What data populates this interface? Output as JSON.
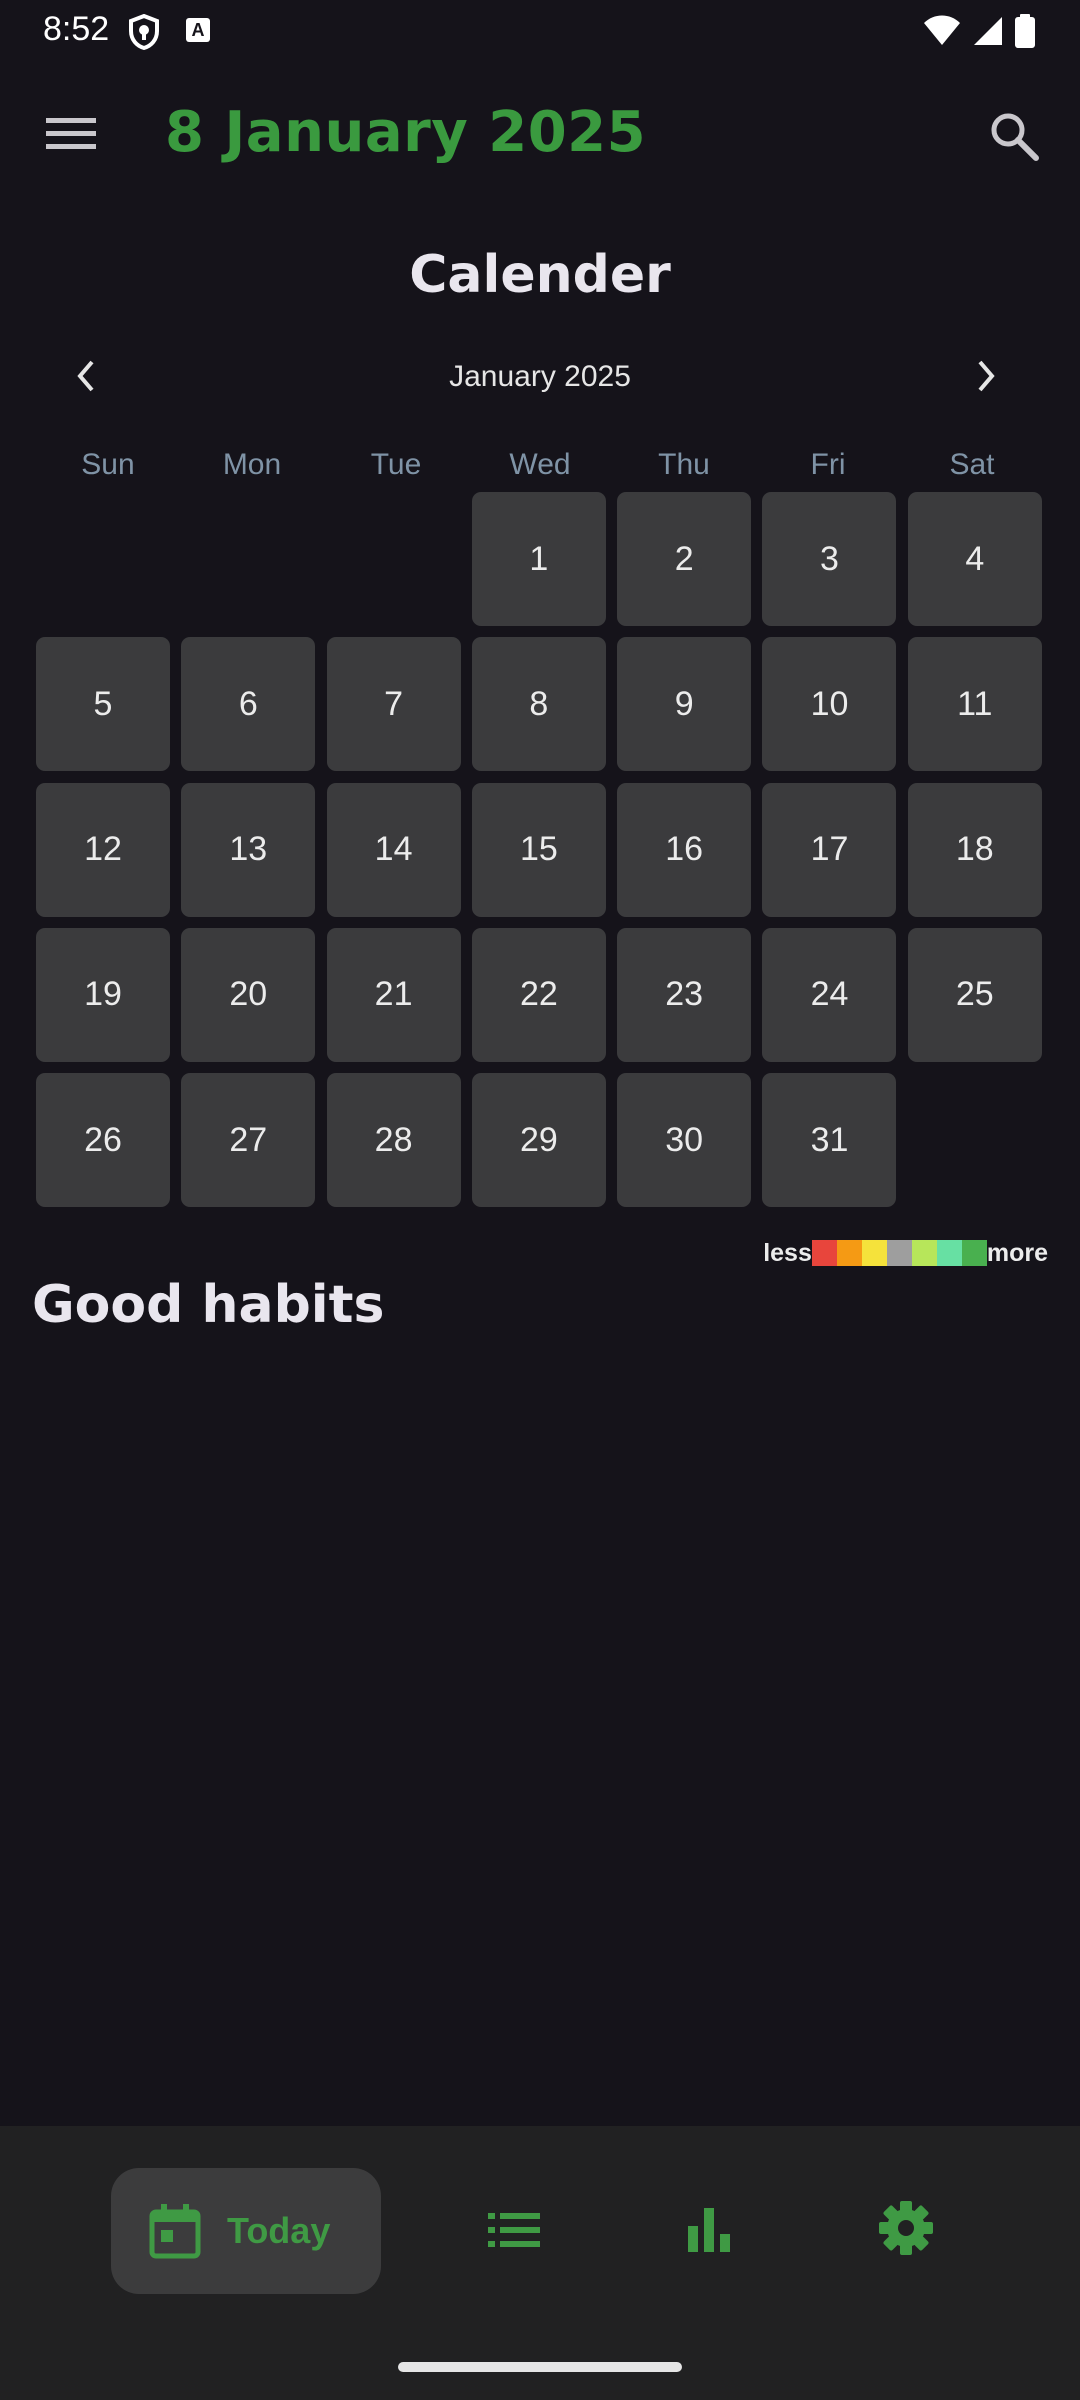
{
  "status_bar": {
    "time": "8:52",
    "a_badge": "A"
  },
  "app_bar": {
    "title": "8 January 2025"
  },
  "calendar": {
    "section_title": "Calender",
    "month_label": "January 2025",
    "weekdays": [
      "Sun",
      "Mon",
      "Tue",
      "Wed",
      "Thu",
      "Fri",
      "Sat"
    ],
    "leading_empty": 3,
    "days": [
      "1",
      "2",
      "3",
      "4",
      "5",
      "6",
      "7",
      "8",
      "9",
      "10",
      "11",
      "12",
      "13",
      "14",
      "15",
      "16",
      "17",
      "18",
      "19",
      "20",
      "21",
      "22",
      "23",
      "24",
      "25",
      "26",
      "27",
      "28",
      "29",
      "30",
      "31"
    ]
  },
  "legend": {
    "less": "less",
    "more": "more",
    "colors": [
      "#e8453c",
      "#f59a14",
      "#f5e23b",
      "#9e9e9e",
      "#b7e65a",
      "#67e0a3",
      "#49b04f"
    ]
  },
  "habits": {
    "title": "Good habits"
  },
  "bottom_nav": {
    "today_label": "Today",
    "accent": "#3f9a44",
    "items": [
      "calendar-icon",
      "list-icon",
      "bar-chart-icon",
      "gear-icon"
    ]
  }
}
